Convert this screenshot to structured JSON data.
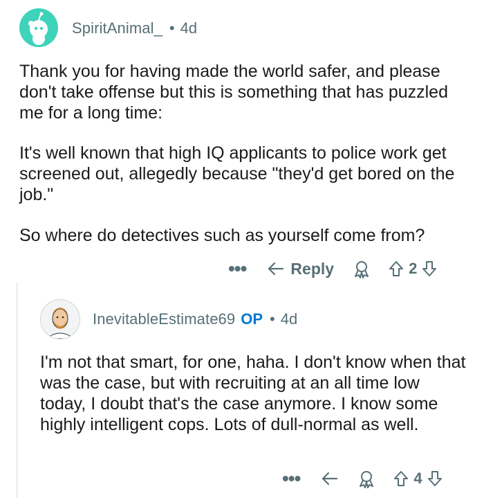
{
  "comments": [
    {
      "username": "SpiritAnimal_",
      "separator": "•",
      "age": "4d",
      "paragraphs": [
        "Thank you for having made the world safer, and please don't take offense but this is something that has puzzled me for a long time:",
        "It's well known that high IQ applicants to police work get screened out, allegedly because \"they'd get bored on the job.\"",
        "So where do detectives such as yourself come from?"
      ],
      "actions": {
        "more": "•••",
        "reply": "Reply",
        "score": "2"
      }
    },
    {
      "username": "InevitableEstimate69",
      "op_badge": "OP",
      "separator": "•",
      "age": "4d",
      "paragraphs": [
        "I'm not that smart, for one, haha. I don't know when that was the case, but with recruiting at an all time low today, I doubt that's the case anymore. I know some highly intelligent cops. Lots of dull-normal as well."
      ],
      "actions": {
        "more": "•••",
        "score": "4"
      }
    }
  ],
  "colors": {
    "avatar_bg": "#3ed3ba",
    "meta": "#576f76",
    "op": "#0079d3",
    "text": "#1a1a1b"
  }
}
